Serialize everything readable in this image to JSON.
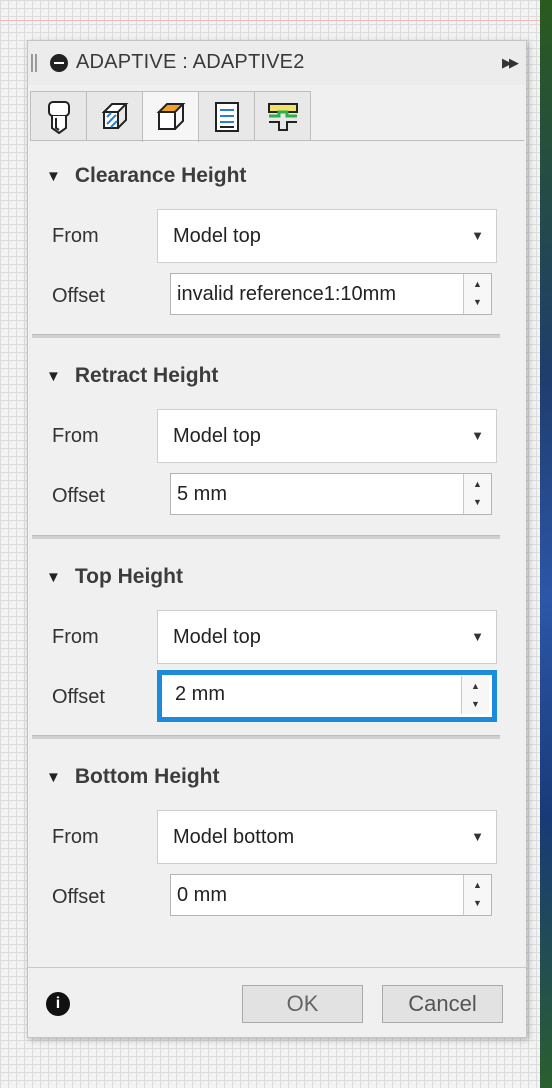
{
  "dialog": {
    "title": "ADAPTIVE : ADAPTIVE2",
    "tabs": [
      {
        "icon": "tool-icon"
      },
      {
        "icon": "geometry-icon"
      },
      {
        "icon": "heights-icon",
        "active": true
      },
      {
        "icon": "passes-icon"
      },
      {
        "icon": "linking-icon"
      }
    ],
    "accent_color": "#1d8bd9"
  },
  "groups": [
    {
      "title": "Clearance Height",
      "from_label": "From",
      "from_value": "Model top",
      "offset_label": "Offset",
      "offset_value": "invalid reference1:10mm"
    },
    {
      "title": "Retract Height",
      "from_label": "From",
      "from_value": "Model top",
      "offset_label": "Offset",
      "offset_value": "5 mm"
    },
    {
      "title": "Top Height",
      "from_label": "From",
      "from_value": "Model top",
      "offset_label": "Offset",
      "offset_value": "2 mm"
    },
    {
      "title": "Bottom Height",
      "from_label": "From",
      "from_value": "Model bottom",
      "offset_label": "Offset",
      "offset_value": "0 mm"
    }
  ],
  "footer": {
    "ok_label": "OK",
    "cancel_label": "Cancel"
  }
}
